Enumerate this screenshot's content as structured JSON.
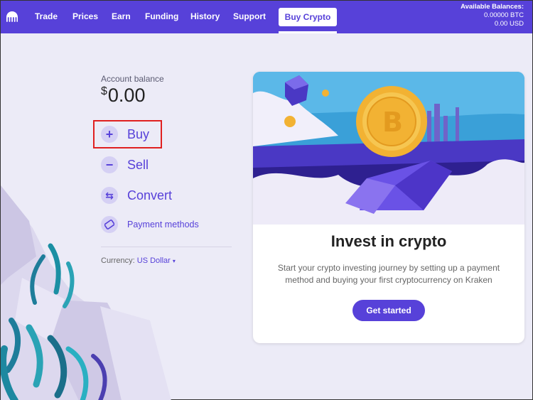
{
  "nav": {
    "items": [
      "Trade",
      "Prices",
      "Earn",
      "Funding",
      "History",
      "Support"
    ],
    "active": "Buy Crypto"
  },
  "balances": {
    "heading": "Available Balances:",
    "btc": "0.00000 BTC",
    "usd": "0.00 USD"
  },
  "account": {
    "label": "Account balance",
    "currency_symbol": "$",
    "value": "0.00"
  },
  "actions": {
    "buy": "Buy",
    "sell": "Sell",
    "convert": "Convert",
    "payment": "Payment methods"
  },
  "currency": {
    "label": "Currency:",
    "value": "US Dollar",
    "caret": "▾"
  },
  "card": {
    "title": "Invest in crypto",
    "description": "Start your crypto investing journey by setting up a payment method and buying your first cryptocurrency on Kraken",
    "button": "Get started"
  },
  "icons": {
    "plus": "+",
    "minus": "−",
    "convert": "⇆"
  },
  "colors": {
    "brand": "#5741d9",
    "highlight": "#e02020"
  }
}
